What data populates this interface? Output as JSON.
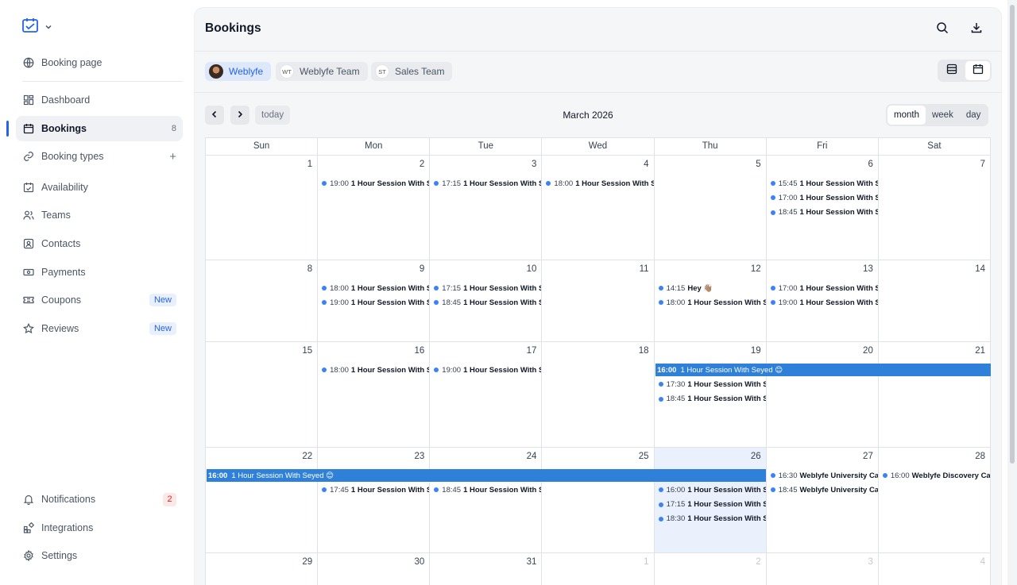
{
  "sidebar": {
    "items": [
      {
        "label": "Booking page",
        "icon": "globe-icon"
      },
      {
        "label": "Dashboard",
        "icon": "dashboard-icon"
      },
      {
        "label": "Bookings",
        "icon": "calendar-icon",
        "count": "8",
        "active": true
      },
      {
        "label": "Booking types",
        "icon": "link-icon",
        "action": "+"
      },
      {
        "label": "Availability",
        "icon": "calendar-check-icon"
      },
      {
        "label": "Teams",
        "icon": "users-icon"
      },
      {
        "label": "Contacts",
        "icon": "contact-icon"
      },
      {
        "label": "Payments",
        "icon": "payments-icon"
      },
      {
        "label": "Coupons",
        "icon": "coupon-icon",
        "badge": "New"
      },
      {
        "label": "Reviews",
        "icon": "star-icon",
        "badge": "New"
      }
    ],
    "bottom": [
      {
        "label": "Notifications",
        "icon": "bell-icon",
        "count": "2"
      },
      {
        "label": "Integrations",
        "icon": "integrations-icon"
      },
      {
        "label": "Settings",
        "icon": "gear-icon"
      }
    ]
  },
  "header": {
    "title": "Bookings"
  },
  "filters": [
    {
      "label": "Weblyfe",
      "avatar": "",
      "selected": true
    },
    {
      "label": "Weblyfe Team",
      "avatar": "WT"
    },
    {
      "label": "Sales Team",
      "avatar": "ST"
    }
  ],
  "calendar": {
    "title": "March 2026",
    "today_label": "today",
    "views": [
      "month",
      "week",
      "day"
    ],
    "active_view": "month",
    "weekdays": [
      "Sun",
      "Mon",
      "Tue",
      "Wed",
      "Thu",
      "Fri",
      "Sat"
    ],
    "weeks": [
      [
        "1",
        "2",
        "3",
        "4",
        "5",
        "6",
        "7"
      ],
      [
        "8",
        "9",
        "10",
        "11",
        "12",
        "13",
        "14"
      ],
      [
        "15",
        "16",
        "17",
        "18",
        "19",
        "20",
        "21"
      ],
      [
        "22",
        "23",
        "24",
        "25",
        "26",
        "27",
        "28"
      ],
      [
        "29",
        "30",
        "31",
        "1",
        "2",
        "3",
        "4"
      ]
    ],
    "events": {
      "0-1": [
        {
          "time": "19:00",
          "name": "1 Hour Session With S"
        }
      ],
      "0-2": [
        {
          "time": "17:15",
          "name": "1 Hour Session With S"
        }
      ],
      "0-3": [
        {
          "time": "18:00",
          "name": "1 Hour Session With S"
        }
      ],
      "0-5": [
        {
          "time": "15:45",
          "name": "1 Hour Session With S"
        },
        {
          "time": "17:00",
          "name": "1 Hour Session With S"
        },
        {
          "time": "18:45",
          "name": "1 Hour Session With S"
        }
      ],
      "1-1": [
        {
          "time": "18:00",
          "name": "1 Hour Session With S"
        },
        {
          "time": "19:00",
          "name": "1 Hour Session With S"
        }
      ],
      "1-2": [
        {
          "time": "17:15",
          "name": "1 Hour Session With S"
        },
        {
          "time": "18:45",
          "name": "1 Hour Session With S"
        }
      ],
      "1-4": [
        {
          "time": "14:15",
          "name": "Hey 👋🏽"
        },
        {
          "time": "18:00",
          "name": "1 Hour Session With S"
        }
      ],
      "1-5": [
        {
          "time": "17:00",
          "name": "1 Hour Session With S"
        },
        {
          "time": "19:00",
          "name": "1 Hour Session With S"
        }
      ],
      "2-1": [
        {
          "time": "18:00",
          "name": "1 Hour Session With S"
        }
      ],
      "2-2": [
        {
          "time": "19:00",
          "name": "1 Hour Session With S"
        }
      ],
      "2-4": [
        {
          "time": "17:30",
          "name": "1 Hour Session With S"
        },
        {
          "time": "18:45",
          "name": "1 Hour Session With S"
        }
      ],
      "3-1": [
        {
          "time": "17:45",
          "name": "1 Hour Session With S"
        }
      ],
      "3-2": [
        {
          "time": "18:45",
          "name": "1 Hour Session With S"
        }
      ],
      "3-4": [
        {
          "time": "16:00",
          "name": "1 Hour Session With S"
        },
        {
          "time": "17:15",
          "name": "1 Hour Session With S"
        },
        {
          "time": "18:30",
          "name": "1 Hour Session With S"
        }
      ],
      "3-5": [
        {
          "time": "16:30",
          "name": "Weblyfe University Ca"
        },
        {
          "time": "18:45",
          "name": "Weblyfe University Ca"
        }
      ],
      "3-6": [
        {
          "time": "16:00",
          "name": "Weblyfe Discovery Ca"
        }
      ]
    },
    "multi_day": [
      {
        "week": 2,
        "start": 4,
        "end": 6,
        "time": "16:00",
        "name": "1 Hour Session With Seyed 😊"
      },
      {
        "week": 3,
        "start": 0,
        "end": 4,
        "time": "16:00",
        "name": "1 Hour Session With Seyed 😊"
      }
    ],
    "highlighted_day": "3-4",
    "accent_color": "#2f80d8"
  }
}
